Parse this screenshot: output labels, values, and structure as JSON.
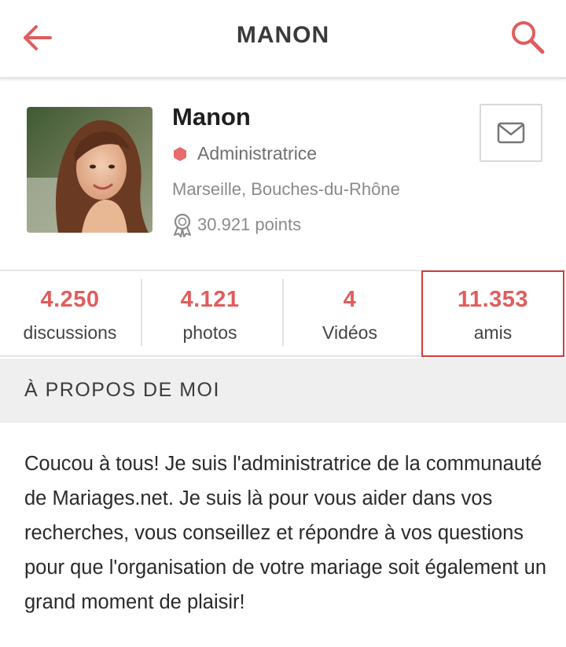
{
  "header": {
    "title": "MANON",
    "back_icon": "arrow-left-icon",
    "search_icon": "search-icon",
    "accent_color": "#e05d5d"
  },
  "profile": {
    "name": "Manon",
    "role": "Administratrice",
    "location": "Marseille, Bouches-du-Rhône",
    "points": "30.921 points",
    "message_icon": "envelope-icon"
  },
  "stats": [
    {
      "value": "4.250",
      "label": "discussions"
    },
    {
      "value": "4.121",
      "label": "photos"
    },
    {
      "value": "4",
      "label": "Vidéos"
    },
    {
      "value": "11.353",
      "label": "amis",
      "selected": true
    }
  ],
  "about": {
    "title": "À PROPOS DE MOI",
    "text": "Coucou à tous! Je suis l'administratrice de la communauté de Mariages.net. Je suis là pour vous aider dans vos recherches, vous conseillez et répondre à vos questions pour que l'organisation de votre mariage soit également un grand moment de plaisir!"
  }
}
